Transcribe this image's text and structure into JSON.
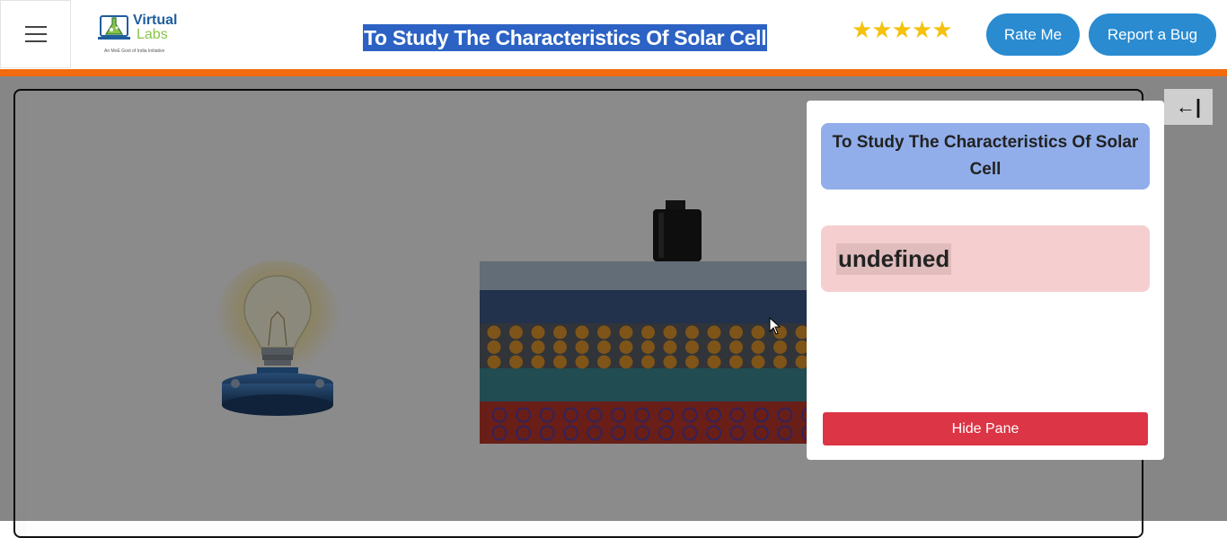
{
  "header": {
    "menu_icon": "hamburger-icon",
    "logo": {
      "main": "Virtual",
      "sub": "Labs",
      "tagline": "An MoE Govt of India Initiative"
    },
    "title": "To Study The Characteristics Of Solar Cell",
    "rating": "★★★★★",
    "rate_label": "Rate Me",
    "bug_label": "Report a Bug"
  },
  "colors": {
    "accent_orange": "#f26b0f",
    "button_blue": "#2a8bd1",
    "title_highlight": "#2c62c4",
    "hide_red": "#dc3545"
  },
  "side_pane": {
    "title": "To Study The Characteristics Of Solar Cell",
    "message": "undefined",
    "hide_label": "Hide Pane",
    "collapse_icon": "←|"
  },
  "simulation": {
    "objects": [
      "light-bulb",
      "solar-cell-panel",
      "terminal"
    ]
  }
}
